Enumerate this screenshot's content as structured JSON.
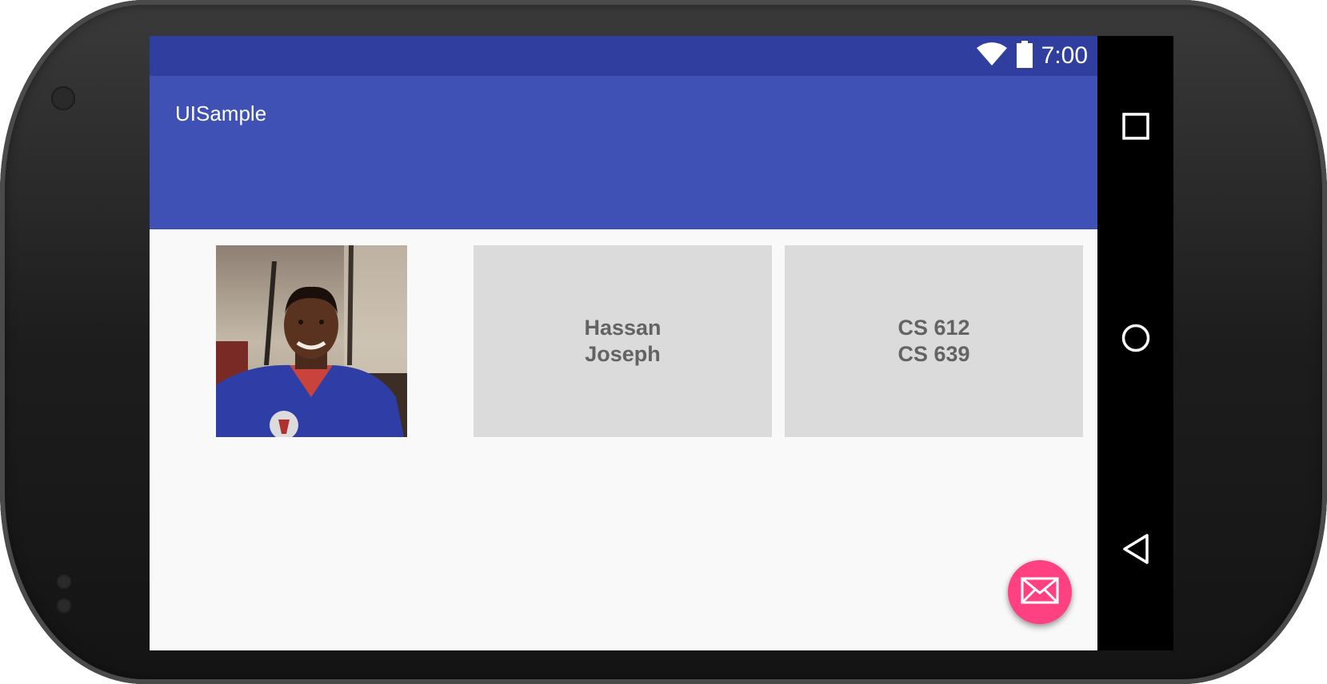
{
  "status_bar": {
    "time": "7:00",
    "icons": [
      "wifi-icon",
      "battery-icon"
    ]
  },
  "toolbar": {
    "title": "UISample"
  },
  "profile": {
    "name_lines": [
      "Hassan",
      "Joseph"
    ],
    "course_lines": [
      "CS 612",
      "CS 639"
    ]
  },
  "fab": {
    "icon": "mail-icon"
  },
  "nav_bar": {
    "buttons": [
      "recents-icon",
      "home-icon",
      "back-icon"
    ]
  },
  "colors": {
    "status_bar": "#303f9f",
    "toolbar": "#3f51b5",
    "fab": "#ff4081",
    "tile": "#dbdbdb",
    "tile_text": "#636363",
    "background": "#f9f9f9"
  }
}
